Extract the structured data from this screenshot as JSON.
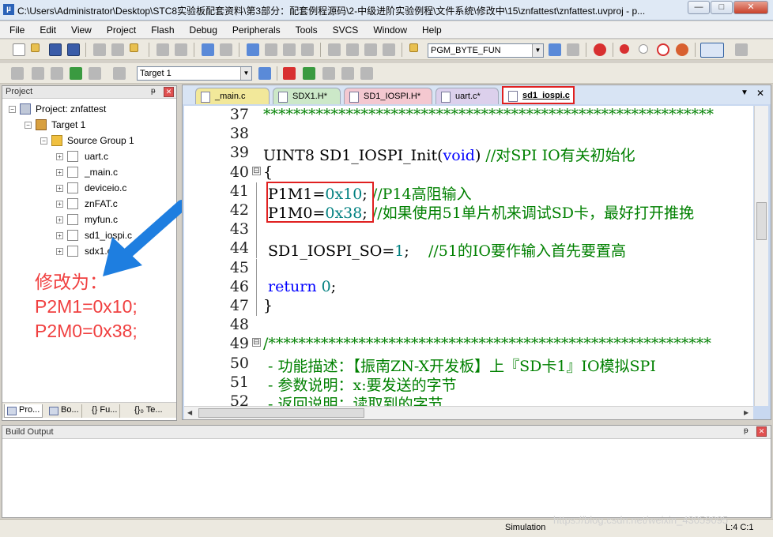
{
  "window": {
    "title": "C:\\Users\\Administrator\\Desktop\\STC8实验板配套资料\\第3部分：配套例程源码\\2-中级进阶实验例程\\文件系统\\修改中\\15\\znfattest\\znfattest.uvproj - p...",
    "minimize": "—",
    "maximize": "□",
    "close": "✕"
  },
  "menu": [
    "File",
    "Edit",
    "View",
    "Project",
    "Flash",
    "Debug",
    "Peripherals",
    "Tools",
    "SVCS",
    "Window",
    "Help"
  ],
  "toolbar": {
    "find_combo": "PGM_BYTE_FUN",
    "target_combo": "Target 1"
  },
  "project_panel": {
    "title": "Project",
    "pin": "ᵽ",
    "close": "✕",
    "tree": {
      "project": "Project: znfattest",
      "target": "Target 1",
      "group": "Source Group 1",
      "files": [
        "uart.c",
        "_main.c",
        "deviceio.c",
        "znFAT.c",
        "myfun.c",
        "sd1_iospi.c",
        "sdx1.c"
      ]
    },
    "tabs": [
      "Pro...",
      "Bo...",
      "{} Fu...",
      "{}₀ Te..."
    ]
  },
  "annotation": {
    "heading": "修改为：",
    "line1": "P2M1=0x10;",
    "line2": "P2M0=0x38;"
  },
  "file_tabs": [
    {
      "label": "_main.c",
      "color": "#f2e89a"
    },
    {
      "label": "SDX1.H*",
      "color": "#cce8c8"
    },
    {
      "label": "SD1_IOSPI.H*",
      "color": "#f4c8d0"
    },
    {
      "label": "uart.c*",
      "color": "#dcd0ec"
    },
    {
      "label": "sd1_iospi.c",
      "color": "#f4f0d8",
      "active": true
    }
  ],
  "editor": {
    "lines": [
      {
        "no": "37",
        "fold": "",
        "segments": [
          {
            "t": "************************************************************",
            "c": "cm"
          }
        ]
      },
      {
        "no": "38",
        "fold": "",
        "segments": []
      },
      {
        "no": "39",
        "fold": "",
        "segments": [
          {
            "t": "UINT8 SD1_IOSPI_Init(",
            "c": ""
          },
          {
            "t": "void",
            "c": "kw"
          },
          {
            "t": ") ",
            "c": ""
          },
          {
            "t": "//对SPI IO有关初始化",
            "c": "cm"
          }
        ]
      },
      {
        "no": "40",
        "fold": "⊟",
        "segments": [
          {
            "t": "{",
            "c": ""
          }
        ]
      },
      {
        "no": "41",
        "fold": "",
        "segments": [
          {
            "t": " P1M1=",
            "c": ""
          },
          {
            "t": "0x10",
            "c": "num"
          },
          {
            "t": "; ",
            "c": ""
          },
          {
            "t": "//P14高阻输入",
            "c": "cm"
          }
        ]
      },
      {
        "no": "42",
        "fold": "",
        "segments": [
          {
            "t": " P1M0=",
            "c": ""
          },
          {
            "t": "0x38",
            "c": "num"
          },
          {
            "t": "; ",
            "c": ""
          },
          {
            "t": "//如果使用51单片机来调试SD卡，最好打开推挽",
            "c": "cm"
          }
        ]
      },
      {
        "no": "43",
        "fold": "",
        "segments": []
      },
      {
        "no": "44",
        "fold": "",
        "segments": [
          {
            "t": " SD1_IOSPI_SO=",
            "c": ""
          },
          {
            "t": "1",
            "c": "num"
          },
          {
            "t": ";    ",
            "c": ""
          },
          {
            "t": "//51的IO要作输入首先要置高",
            "c": "cm"
          }
        ]
      },
      {
        "no": "45",
        "fold": "",
        "segments": []
      },
      {
        "no": "46",
        "fold": "",
        "segments": [
          {
            "t": " ",
            "c": ""
          },
          {
            "t": "return",
            "c": "kw"
          },
          {
            "t": " ",
            "c": ""
          },
          {
            "t": "0",
            "c": "num"
          },
          {
            "t": ";",
            "c": ""
          }
        ]
      },
      {
        "no": "47",
        "fold": "",
        "segments": [
          {
            "t": "}",
            "c": ""
          }
        ]
      },
      {
        "no": "48",
        "fold": "",
        "segments": []
      },
      {
        "no": "49",
        "fold": "⊟",
        "segments": [
          {
            "t": "/***********************************************************",
            "c": "cm"
          }
        ]
      },
      {
        "no": "50",
        "fold": "",
        "segments": [
          {
            "t": " - 功能描述：【振南ZN-X开发板】上『SD卡1』IO模拟SPI",
            "c": "cm"
          }
        ]
      },
      {
        "no": "51",
        "fold": "",
        "segments": [
          {
            "t": " - 参数说明：x:要发送的字节",
            "c": "cm"
          }
        ]
      },
      {
        "no": "52",
        "fold": "",
        "segments": [
          {
            "t": " - 返回说明：读取到的字节",
            "c": "cm"
          }
        ]
      }
    ]
  },
  "build_output": {
    "title": "Build Output"
  },
  "status": {
    "mode": "Simulation",
    "position": "L:4 C:1",
    "watermark": "https://blog.csdn.net/weixin_43059095"
  }
}
